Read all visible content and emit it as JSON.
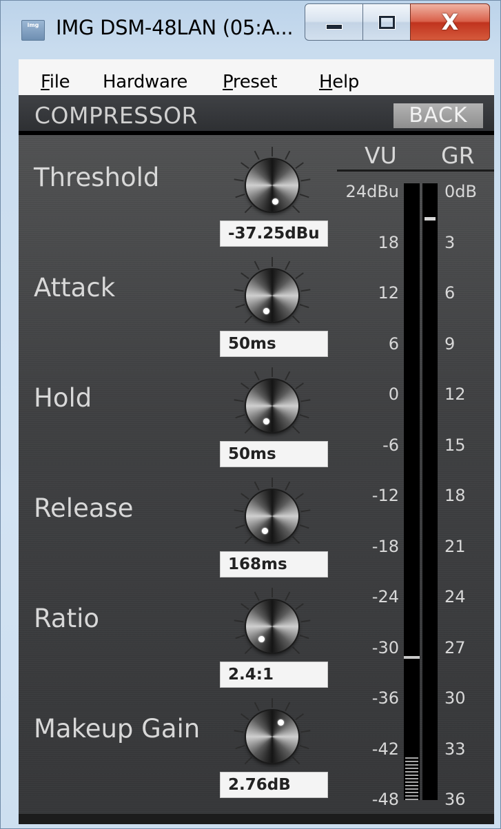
{
  "window": {
    "title": "IMG DSM-48LAN (05:A...",
    "icon_text": "img",
    "minimize_icon": "minimize-icon",
    "maximize_icon": "maximize-icon",
    "close_glyph": "X"
  },
  "menu": {
    "items": [
      {
        "hot": "F",
        "rest": "ile"
      },
      {
        "hot": "",
        "rest": "Hardware"
      },
      {
        "hot": "P",
        "rest": "reset"
      },
      {
        "hot": "H",
        "rest": "elp"
      }
    ]
  },
  "header": {
    "title": "COMPRESSOR",
    "back_label": "BACK"
  },
  "params": [
    {
      "label": "Threshold",
      "value": "-37.25dBu",
      "knob_angle_deg": 170
    },
    {
      "label": "Attack",
      "value": "50ms",
      "knob_angle_deg": 200
    },
    {
      "label": "Hold",
      "value": "50ms",
      "knob_angle_deg": 200
    },
    {
      "label": "Release",
      "value": "168ms",
      "knob_angle_deg": 205
    },
    {
      "label": "Ratio",
      "value": "2.4:1",
      "knob_angle_deg": 220
    },
    {
      "label": "Makeup Gain",
      "value": "2.76dB",
      "knob_angle_deg": 30
    }
  ],
  "meters": {
    "vu_title": "VU",
    "gr_title": "GR",
    "vu_scale": [
      "24dBu",
      "18",
      "12",
      "6",
      "0",
      "-6",
      "-12",
      "-18",
      "-24",
      "-30",
      "-36",
      "-42",
      "-48"
    ],
    "gr_scale": [
      "0dB",
      "3",
      "6",
      "9",
      "12",
      "15",
      "18",
      "21",
      "24",
      "27",
      "30",
      "33",
      "36"
    ],
    "vu_marker_dbu": -31,
    "gr_marker_db": 1.5,
    "colors": {
      "panel": "#3e3f41",
      "bar": "#000000",
      "marker": "#c9c9c9"
    }
  }
}
